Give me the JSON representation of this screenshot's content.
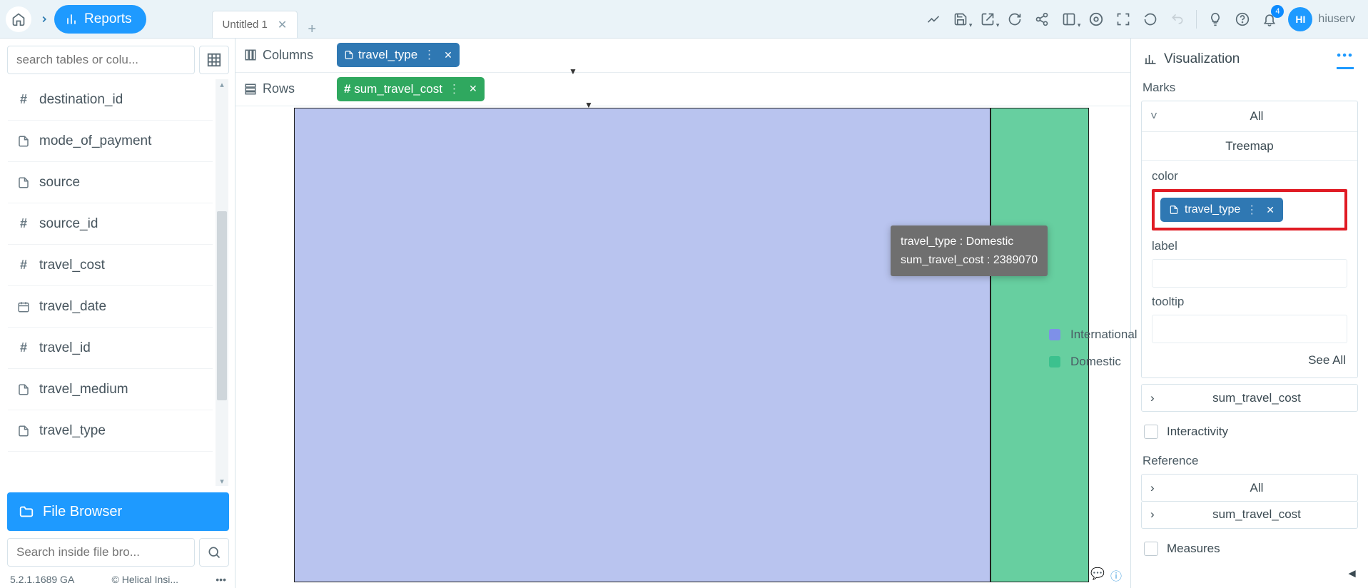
{
  "breadcrumb": {
    "reports_label": "Reports"
  },
  "tabs": [
    {
      "label": "Untitled 1"
    }
  ],
  "user": {
    "initials": "HI",
    "name": "hiuserv"
  },
  "notifications": {
    "count": "4"
  },
  "left_panel": {
    "search_placeholder": "search tables or colu...",
    "fields": [
      {
        "icon": "hash",
        "label": "destination_id"
      },
      {
        "icon": "doc",
        "label": "mode_of_payment"
      },
      {
        "icon": "doc",
        "label": "source"
      },
      {
        "icon": "hash",
        "label": "source_id"
      },
      {
        "icon": "hash",
        "label": "travel_cost"
      },
      {
        "icon": "cal",
        "label": "travel_date"
      },
      {
        "icon": "hash",
        "label": "travel_id"
      },
      {
        "icon": "doc",
        "label": "travel_medium"
      },
      {
        "icon": "doc",
        "label": "travel_type"
      }
    ],
    "file_browser_label": "File Browser",
    "fb_search_placeholder": "Search inside file bro...",
    "version": "5.2.1.1689 GA",
    "copyright": "© Helical Insi..."
  },
  "shelves": {
    "columns_label": "Columns",
    "rows_label": "Rows",
    "columns_pill": "travel_type",
    "rows_pill": "sum_travel_cost"
  },
  "tooltip": {
    "line1": "travel_type : Domestic",
    "line2": "sum_travel_cost : 2389070"
  },
  "legend": {
    "intl": "International",
    "dom": "Domestic"
  },
  "right_panel": {
    "viz_label": "Visualization",
    "marks_label": "Marks",
    "all_label": "All",
    "treemap_label": "Treemap",
    "color_label": "color",
    "color_pill": "travel_type",
    "label_label": "label",
    "tooltip_label": "tooltip",
    "see_all": "See All",
    "sum_row": "sum_travel_cost",
    "interactivity": "Interactivity",
    "reference": "Reference",
    "ref_all": "All",
    "ref_sum": "sum_travel_cost",
    "measures": "Measures"
  },
  "chart_data": {
    "type": "area",
    "title": "Treemap",
    "series": [
      {
        "name": "International",
        "value": 16900000,
        "color": "#b9c4ef"
      },
      {
        "name": "Domestic",
        "value": 2389070,
        "color": "#67cfa0"
      }
    ],
    "dimension": "travel_type",
    "measure": "sum_travel_cost"
  }
}
